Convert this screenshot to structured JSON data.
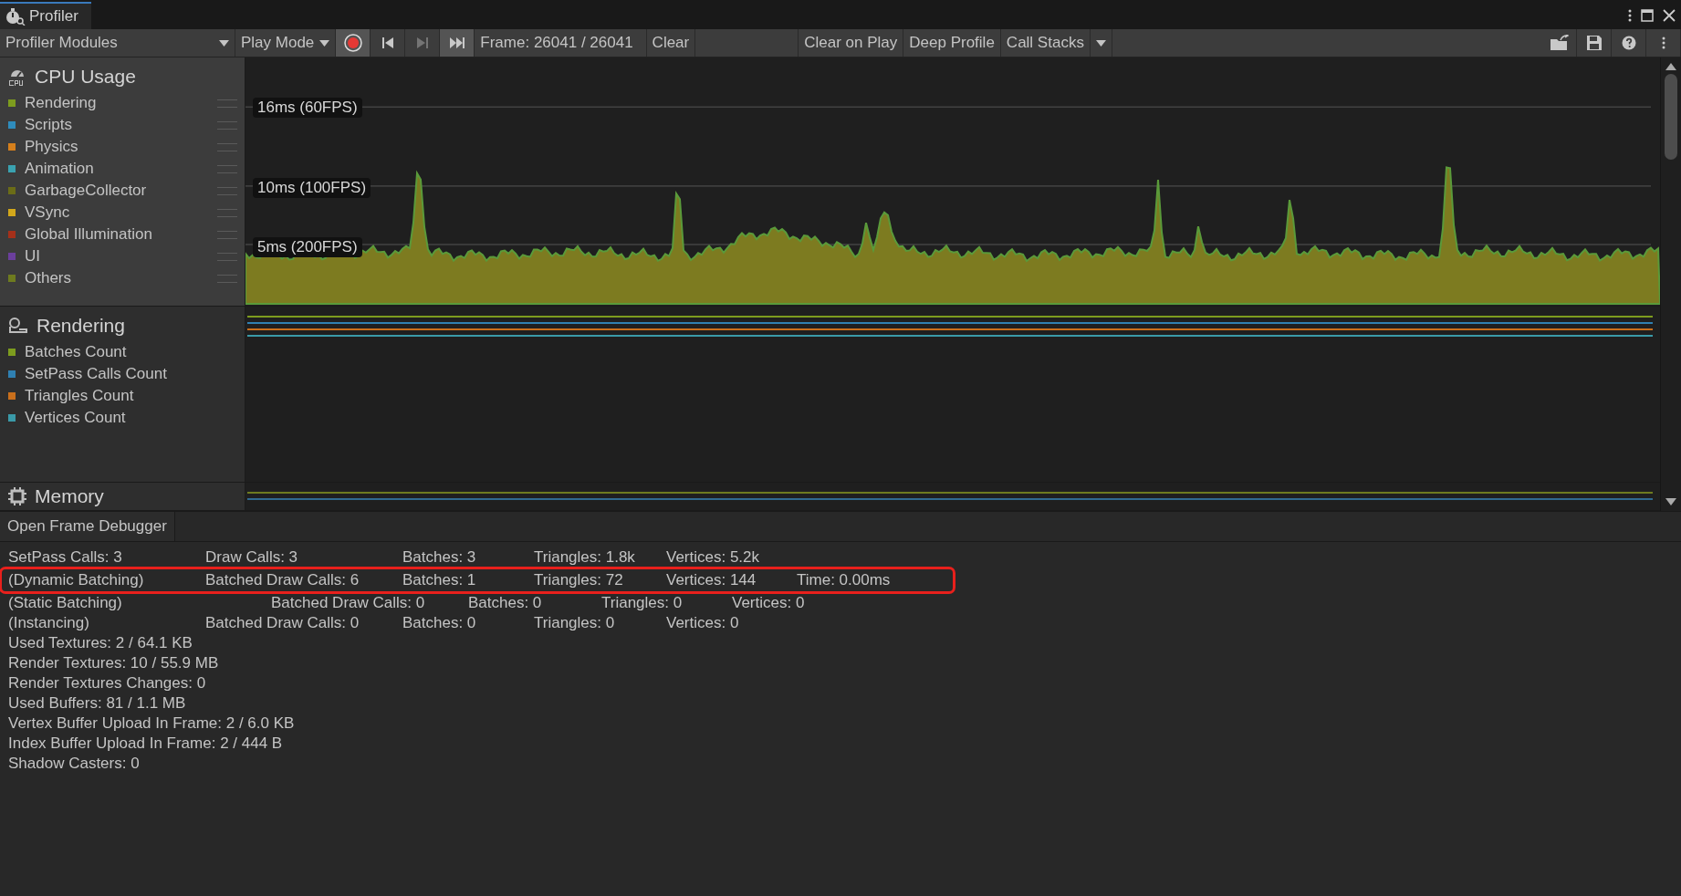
{
  "window": {
    "tab": "Profiler"
  },
  "toolbar": {
    "modules_dropdown": "Profiler Modules",
    "play_mode": "Play Mode",
    "recording": true,
    "nav": [
      {
        "kind": "first",
        "disabled": false,
        "active": false
      },
      {
        "kind": "next",
        "disabled": true,
        "active": false
      },
      {
        "kind": "last",
        "disabled": false,
        "active": true
      }
    ],
    "frame": "Frame: 26041 / 26041",
    "buttons": [
      "Clear"
    ],
    "toggles": [
      "Clear on Play",
      "Deep Profile"
    ],
    "call_stacks": "Call Stacks"
  },
  "modules": [
    {
      "kind": "cpu",
      "title": "CPU Usage",
      "selected": true,
      "handles": true,
      "guides": [
        "16ms (60FPS)",
        "10ms (100FPS)",
        "5ms (200FPS)"
      ],
      "legend": [
        {
          "label": "Rendering",
          "color": "#7d9c1e"
        },
        {
          "label": "Scripts",
          "color": "#2f8cbc"
        },
        {
          "label": "Physics",
          "color": "#d57f1c"
        },
        {
          "label": "Animation",
          "color": "#3aa2b0"
        },
        {
          "label": "GarbageCollector",
          "color": "#6b6c17"
        },
        {
          "label": "VSync",
          "color": "#d2a71b"
        },
        {
          "label": "Global Illumination",
          "color": "#a5301a"
        },
        {
          "label": "UI",
          "color": "#6b3f9c"
        },
        {
          "label": "Others",
          "color": "#6e7b1f"
        }
      ]
    },
    {
      "kind": "rendering",
      "title": "Rendering",
      "selected": false,
      "handles": false,
      "legend": [
        {
          "label": "Batches Count",
          "color": "#7d9c1e"
        },
        {
          "label": "SetPass Calls Count",
          "color": "#2f80b2"
        },
        {
          "label": "Triangles Count",
          "color": "#c96f1c"
        },
        {
          "label": "Vertices Count",
          "color": "#3a9aa8"
        }
      ]
    },
    {
      "kind": "memory",
      "title": "Memory",
      "selected": false
    }
  ],
  "frame_debugger_button": "Open Frame Debugger",
  "stats": [
    {
      "kind": "grid",
      "highlighted": false,
      "cells": [
        "SetPass Calls: 3",
        "Draw Calls: 3",
        "Batches: 3",
        "Triangles: 1.8k",
        "Vertices: 5.2k"
      ]
    },
    {
      "kind": "grid",
      "highlighted": true,
      "cells": [
        "(Dynamic Batching)",
        "Batched Draw Calls: 6",
        "Batches: 1",
        "Triangles: 72",
        "Vertices: 144",
        "Time: 0.00ms"
      ]
    },
    {
      "kind": "shifted",
      "highlighted": false,
      "cells": [
        "(Static Batching)",
        "Batched Draw Calls: 0",
        "Batches: 0",
        "Triangles: 0",
        "Vertices: 0"
      ]
    },
    {
      "kind": "grid",
      "highlighted": false,
      "cells": [
        "(Instancing)",
        "Batched Draw Calls: 0",
        "Batches: 0",
        "Triangles: 0",
        "Vertices: 0"
      ]
    },
    {
      "kind": "single",
      "highlighted": false,
      "cells": [
        "Used Textures: 2 / 64.1 KB"
      ]
    },
    {
      "kind": "single",
      "highlighted": false,
      "cells": [
        "Render Textures: 10 / 55.9 MB"
      ]
    },
    {
      "kind": "single",
      "highlighted": false,
      "cells": [
        "Render Textures Changes: 0"
      ]
    },
    {
      "kind": "single",
      "highlighted": false,
      "cells": [
        "Used Buffers: 81 / 1.1 MB"
      ]
    },
    {
      "kind": "single",
      "highlighted": false,
      "cells": [
        "Vertex Buffer Upload In Frame: 2 / 6.0 KB"
      ]
    },
    {
      "kind": "single",
      "highlighted": false,
      "cells": [
        "Index Buffer Upload In Frame: 2 / 444 B"
      ]
    },
    {
      "kind": "single",
      "highlighted": false,
      "cells": [
        "Shadow Casters: 0"
      ]
    }
  ]
}
